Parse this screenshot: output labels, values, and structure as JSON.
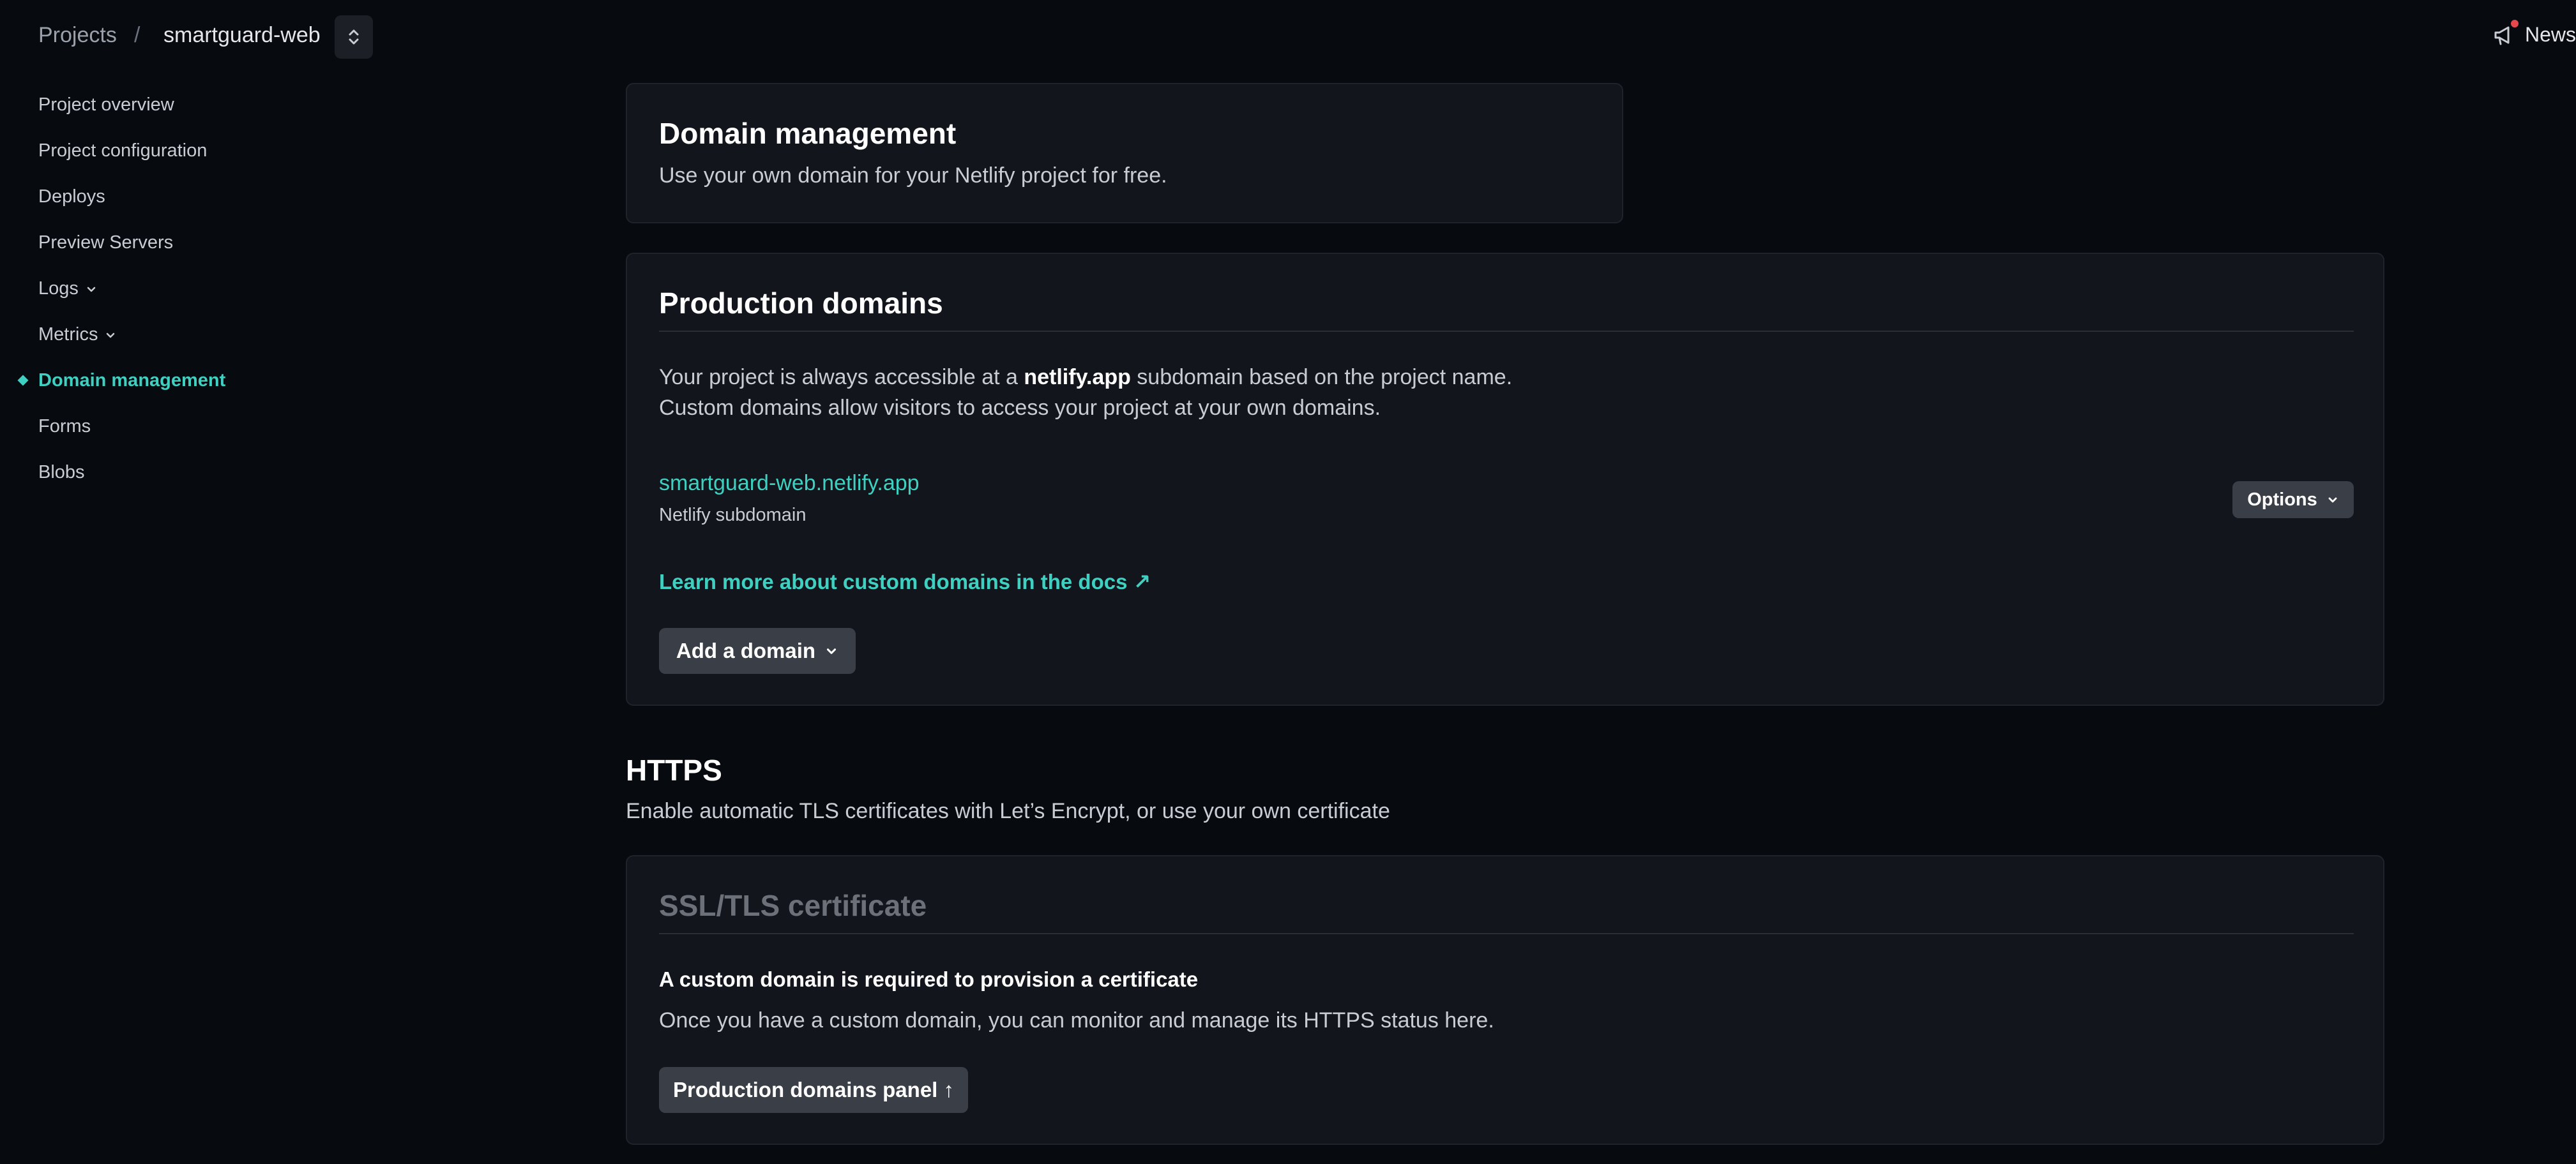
{
  "breadcrumb": {
    "projects_label": "Projects",
    "separator": "/",
    "site_name": "smartguard-web"
  },
  "news": {
    "label": "News"
  },
  "sidebar": {
    "items": [
      {
        "label": "Project overview"
      },
      {
        "label": "Project configuration"
      },
      {
        "label": "Deploys"
      },
      {
        "label": "Preview Servers"
      },
      {
        "label": "Logs"
      },
      {
        "label": "Metrics"
      },
      {
        "label": "Domain management"
      },
      {
        "label": "Forms"
      },
      {
        "label": "Blobs"
      }
    ],
    "active": "Domain management"
  },
  "domain_management": {
    "title": "Domain management",
    "description": "Use your own domain for your Netlify project for free."
  },
  "production_domains": {
    "title": "Production domains",
    "line1_prefix": "Your project is always accessible at a ",
    "line1_bold": "netlify.app",
    "line1_suffix": " subdomain based on the project name.",
    "line2": "Custom domains allow visitors to access your project at your own domains.",
    "domain_name": "smartguard-web.netlify.app",
    "domain_type": "Netlify subdomain",
    "options_label": "Options",
    "docs_link": "Learn more about custom domains in the docs ↗",
    "add_domain_label": "Add a domain"
  },
  "https": {
    "title": "HTTPS",
    "description": "Enable automatic TLS certificates with Let’s Encrypt, or use your own certificate"
  },
  "ssl": {
    "title": "SSL/TLS certificate",
    "requirement": "A custom domain is required to provision a certificate",
    "description": "Once you have a custom domain, you can monitor and manage its HTTPS status here.",
    "panel_button": "Production domains panel ↑"
  },
  "colors": {
    "background": "#070a0f",
    "card": "#12151b",
    "accent": "#3fd0c2",
    "button": "#3a3e47",
    "notification": "#e5484d"
  }
}
